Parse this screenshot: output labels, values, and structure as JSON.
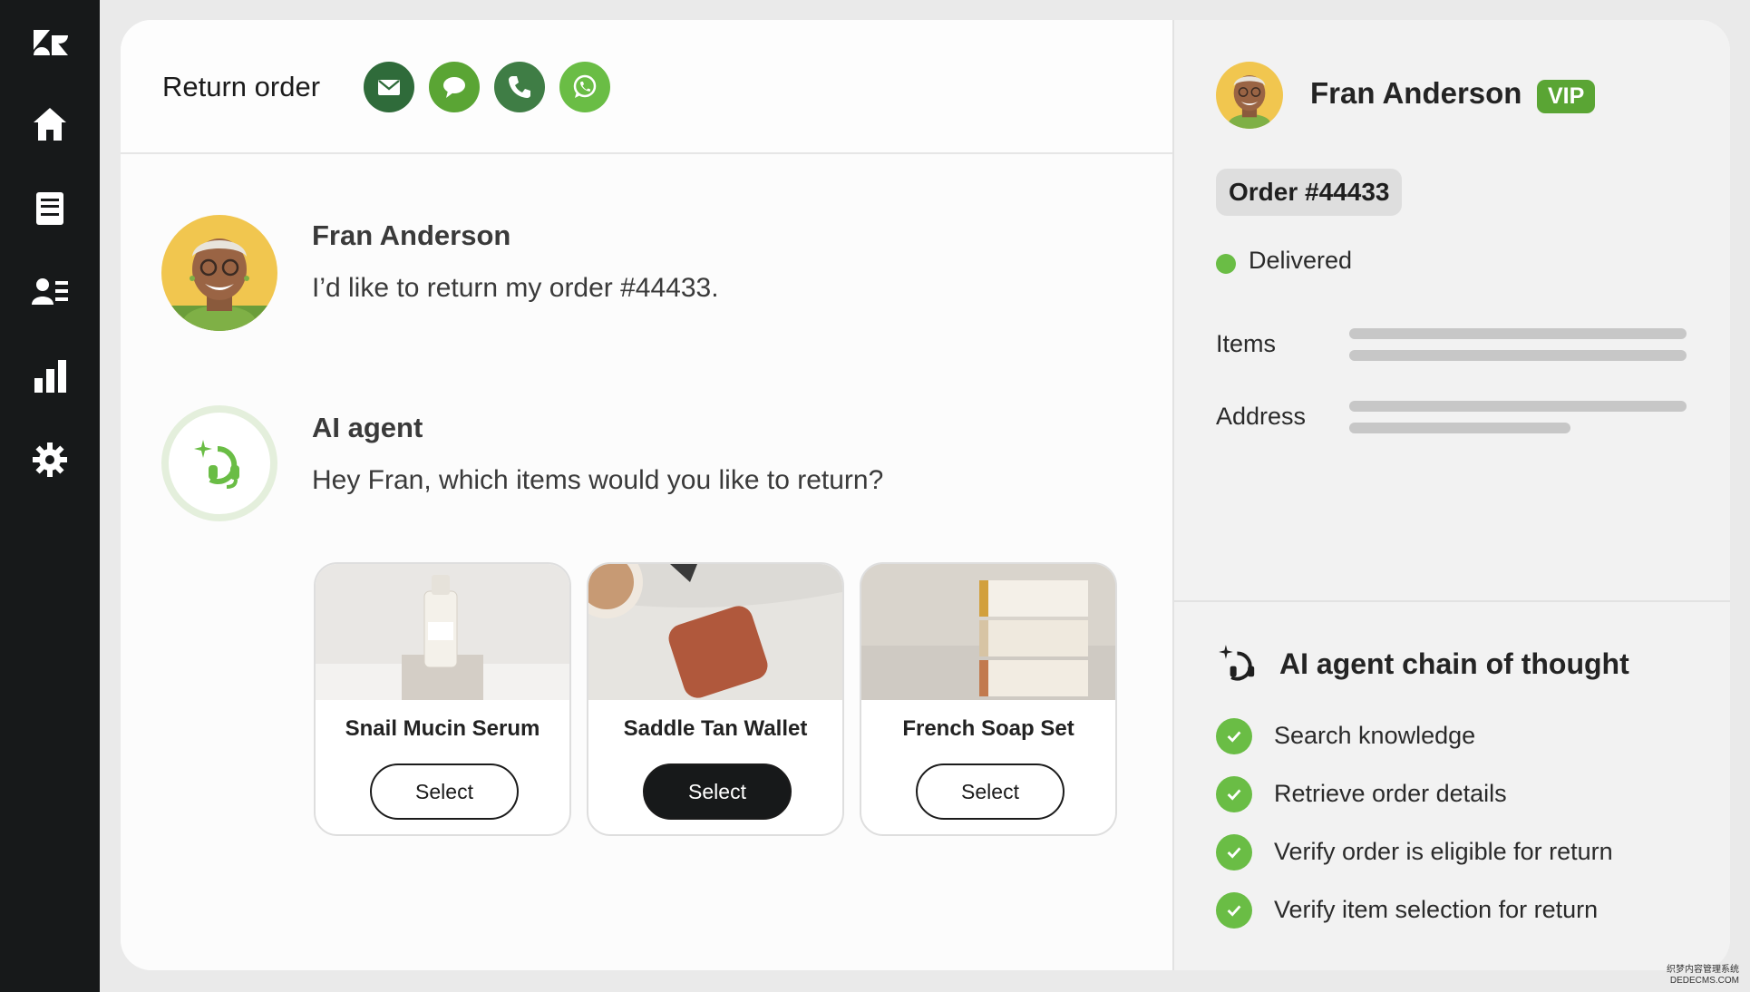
{
  "nav": {
    "items": [
      {
        "icon": "zendesk-logo-icon"
      },
      {
        "icon": "home-icon"
      },
      {
        "icon": "tickets-icon"
      },
      {
        "icon": "contacts-icon"
      },
      {
        "icon": "reporting-icon"
      },
      {
        "icon": "settings-icon"
      }
    ]
  },
  "header": {
    "title": "Return order",
    "channels": [
      {
        "icon": "email-icon",
        "color": "#2f6b3a"
      },
      {
        "icon": "chat-icon",
        "color": "#5aa534"
      },
      {
        "icon": "phone-icon",
        "color": "#3f7d45"
      },
      {
        "icon": "whatsapp-icon",
        "color": "#6abd45"
      }
    ]
  },
  "conversation": {
    "customer": {
      "name": "Fran Anderson",
      "text": "I’d like to return my order #44433."
    },
    "agent": {
      "name": "AI agent",
      "text": "Hey Fran, which items would you like to return?"
    },
    "products": [
      {
        "name": "Snail Mucin Serum",
        "button": "Select",
        "selected": false
      },
      {
        "name": "Saddle Tan Wallet",
        "button": "Select",
        "selected": true
      },
      {
        "name": "French Soap Set",
        "button": "Select",
        "selected": false
      }
    ]
  },
  "side": {
    "name": "Fran Anderson",
    "badge": "VIP",
    "order": "Order #44433",
    "status": "Delivered",
    "items_label": "Items",
    "address_label": "Address",
    "cot_title": "AI agent chain of thought",
    "steps": [
      "Search knowledge",
      "Retrieve order details",
      "Verify order is eligible for return",
      "Verify item selection for return"
    ]
  },
  "watermark": {
    "line1": "织梦内容管理系统",
    "line2": "DEDECMS.COM"
  },
  "colors": {
    "accent_green": "#6abd45",
    "vip_green": "#5aa534",
    "dark": "#17191a"
  }
}
